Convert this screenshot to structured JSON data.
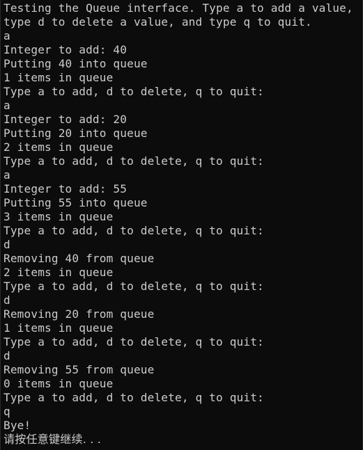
{
  "console": {
    "lines": [
      "Testing the Queue interface. Type a to add a value,",
      "type d to delete a value, and type q to quit.",
      "a",
      "Integer to add: 40",
      "Putting 40 into queue",
      "1 items in queue",
      "Type a to add, d to delete, q to quit:",
      "a",
      "Integer to add: 20",
      "Putting 20 into queue",
      "2 items in queue",
      "Type a to add, d to delete, q to quit:",
      "a",
      "Integer to add: 55",
      "Putting 55 into queue",
      "3 items in queue",
      "Type a to add, d to delete, q to quit:",
      "d",
      "Removing 40 from queue",
      "2 items in queue",
      "Type a to add, d to delete, q to quit:",
      "d",
      "Removing 20 from queue",
      "1 items in queue",
      "Type a to add, d to delete, q to quit:",
      "d",
      "Removing 55 from queue",
      "0 items in queue",
      "Type a to add, d to delete, q to quit:",
      "q",
      "Bye!",
      "请按任意键继续. . ."
    ]
  }
}
